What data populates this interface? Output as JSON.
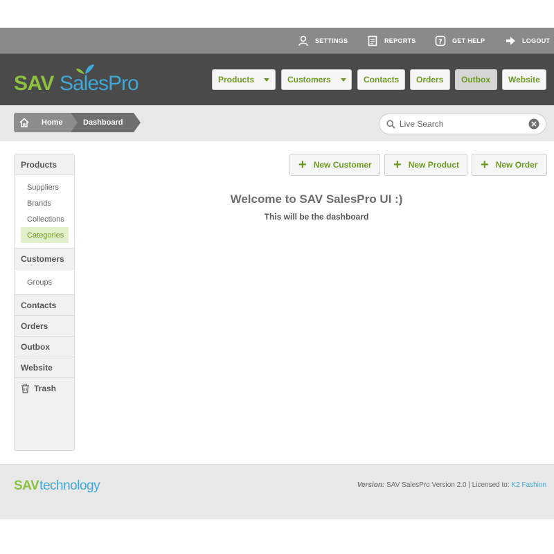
{
  "topbar": {
    "settings": "SETTINGS",
    "reports": "REPORTS",
    "help": "GET HELP",
    "logout": "LOGOUT"
  },
  "brand": {
    "sav": "SAV",
    "salespro": "SalesPro"
  },
  "nav": {
    "products": "Products",
    "customers": "Customers",
    "contacts": "Contacts",
    "orders": "Orders",
    "outbox": "Outbox",
    "website": "Website",
    "active": "Outbox"
  },
  "breadcrumb": {
    "home": "Home",
    "current": "Dashboard"
  },
  "search": {
    "placeholder": "Live Search",
    "value": ""
  },
  "sidebar": {
    "products": "Products",
    "product_items": [
      "Suppliers",
      "Brands",
      "Collections",
      "Categories"
    ],
    "selected": "Categories",
    "customers": "Customers",
    "customer_items": [
      "Groups"
    ],
    "contacts": "Contacts",
    "orders": "Orders",
    "outbox": "Outbox",
    "website": "Website",
    "trash": "Trash"
  },
  "actions": {
    "new_customer": "New Customer",
    "new_product": "New Product",
    "new_order": "New Order"
  },
  "main": {
    "welcome": "Welcome to SAV SalesPro UI :)",
    "subtitle": "This will be the dashboard"
  },
  "footer": {
    "logo_sav": "SAV",
    "logo_tech": "technology",
    "version_label": "Version:",
    "version_text": " SAV SalesPro Version 2.0 | Licensed to: ",
    "licensee": "K2 Fashion"
  },
  "colors": {
    "accent_green": "#6c9a22",
    "brand_green": "#8cc23e",
    "brand_blue": "#3fa8d6",
    "header": "#4a4a4a"
  }
}
